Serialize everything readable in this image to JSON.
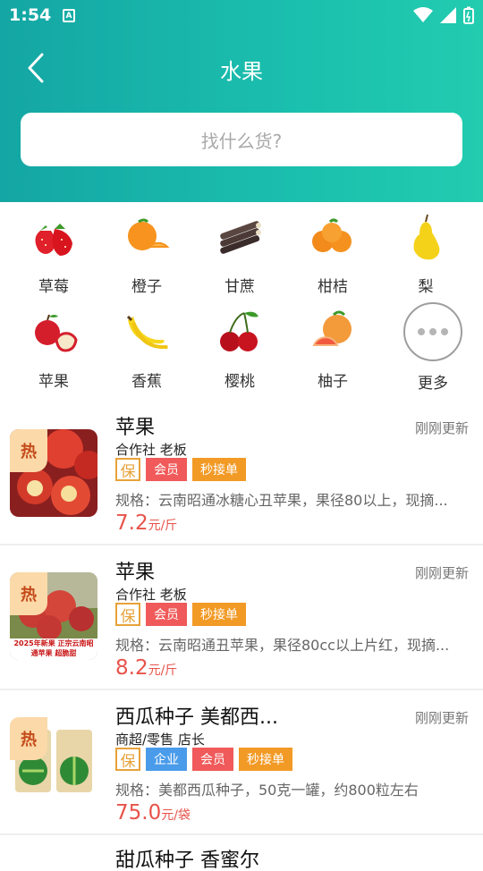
{
  "status": {
    "time": "1:54",
    "a_badge": "A"
  },
  "header": {
    "title": "水果",
    "back_icon": "chevron-left-icon"
  },
  "search": {
    "placeholder": "找什么货?"
  },
  "categories": [
    {
      "label": "草莓",
      "icon": "strawberry-icon"
    },
    {
      "label": "橙子",
      "icon": "orange-icon"
    },
    {
      "label": "甘蔗",
      "icon": "sugarcane-icon"
    },
    {
      "label": "柑桔",
      "icon": "tangerine-icon"
    },
    {
      "label": "梨",
      "icon": "pear-icon"
    },
    {
      "label": "苹果",
      "icon": "apple-icon"
    },
    {
      "label": "香蕉",
      "icon": "banana-icon"
    },
    {
      "label": "樱桃",
      "icon": "cherry-icon"
    },
    {
      "label": "柚子",
      "icon": "grapefruit-icon"
    },
    {
      "label": "更多",
      "icon": "more-icon"
    }
  ],
  "listings": [
    {
      "hot": "热",
      "title": "苹果",
      "updated": "刚刚更新",
      "seller": "合作社 老板",
      "bao": "保",
      "tags": [
        "会员",
        "秒接单"
      ],
      "spec": "规格：云南昭通冰糖心丑苹果，果径80以上，现摘...",
      "price": "7.2",
      "unit": "元/斤"
    },
    {
      "hot": "热",
      "title": "苹果",
      "updated": "刚刚更新",
      "seller": "合作社 老板",
      "bao": "保",
      "tags": [
        "会员",
        "秒接单"
      ],
      "spec": "规格：云南昭通丑苹果，果径80cc以上片红，现摘...",
      "price": "8.2",
      "unit": "元/斤",
      "image_text": "2025年新果 正宗云南昭通苹果 超脆甜"
    },
    {
      "hot": "热",
      "title": "西瓜种子 美都西...",
      "updated": "刚刚更新",
      "seller": "商超/零售 店长",
      "bao": "保",
      "tags": [
        "企业",
        "会员",
        "秒接单"
      ],
      "spec": "规格：美都西瓜种子，50克一罐，约800粒左右",
      "price": "75.0",
      "unit": "元/袋"
    },
    {
      "title": "甜瓜种子 香蜜尔"
    }
  ],
  "colors": {
    "header_start": "#14a6a4",
    "header_end": "#22ccaf",
    "price": "#e7534a",
    "tag_member": "#f05a5a",
    "tag_fast": "#f29a26",
    "tag_company": "#4a9bea",
    "bao": "#e7a23a"
  }
}
